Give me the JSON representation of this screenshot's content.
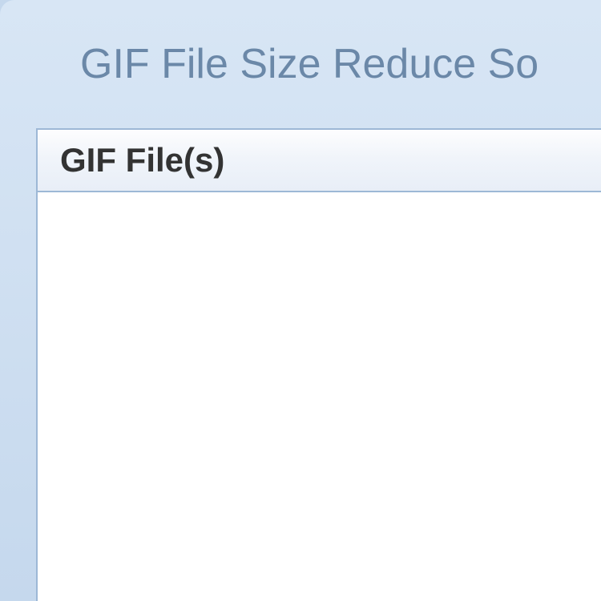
{
  "window": {
    "title": "GIF File Size Reduce So"
  },
  "list": {
    "column_header": "GIF File(s)",
    "items": []
  }
}
